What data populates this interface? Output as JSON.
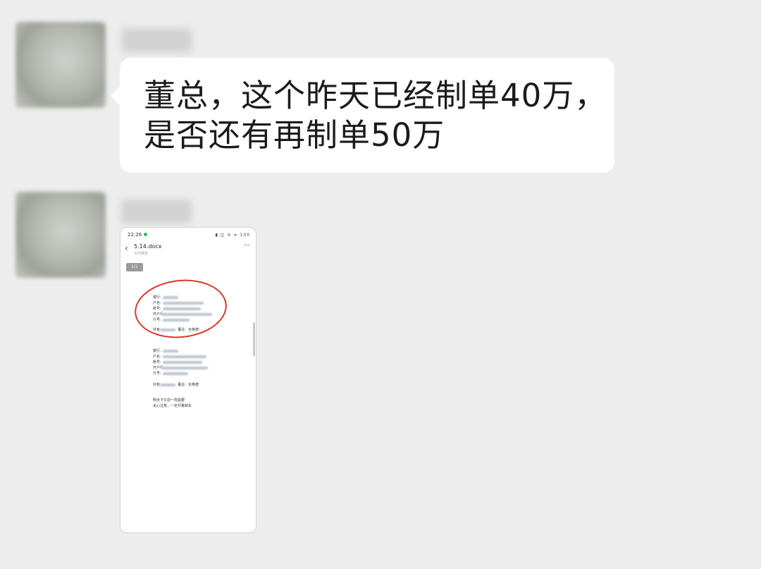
{
  "chat": {
    "message1": {
      "line1": "董总，这个昨天已经制单40万，",
      "line2": "是否还有再制单50万"
    },
    "attachment": {
      "status_time": "22:26",
      "status_icons": "▮ ◫ ≋ ᯤ 100",
      "file_name": "5.14.docx",
      "file_subtitle": "文件预览",
      "page_indicator": "1/1",
      "doc_block1": {
        "labels": [
          "银行:",
          "户名:",
          "账号:",
          "开户行:",
          "行号:"
        ],
        "amount_label": "共有",
        "amount_suffix": "· 董总 · 全英德"
      },
      "doc_block2": {
        "labels": [
          "银行:",
          "户名:",
          "账号:",
          "开户行:",
          "行号:"
        ],
        "amount_label": "共有",
        "amount_suffix": "· 董总 · 全英德"
      },
      "doc_footer": [
        "明天下午前一周需要",
        "关心注意，一定尽量转车"
      ]
    }
  }
}
